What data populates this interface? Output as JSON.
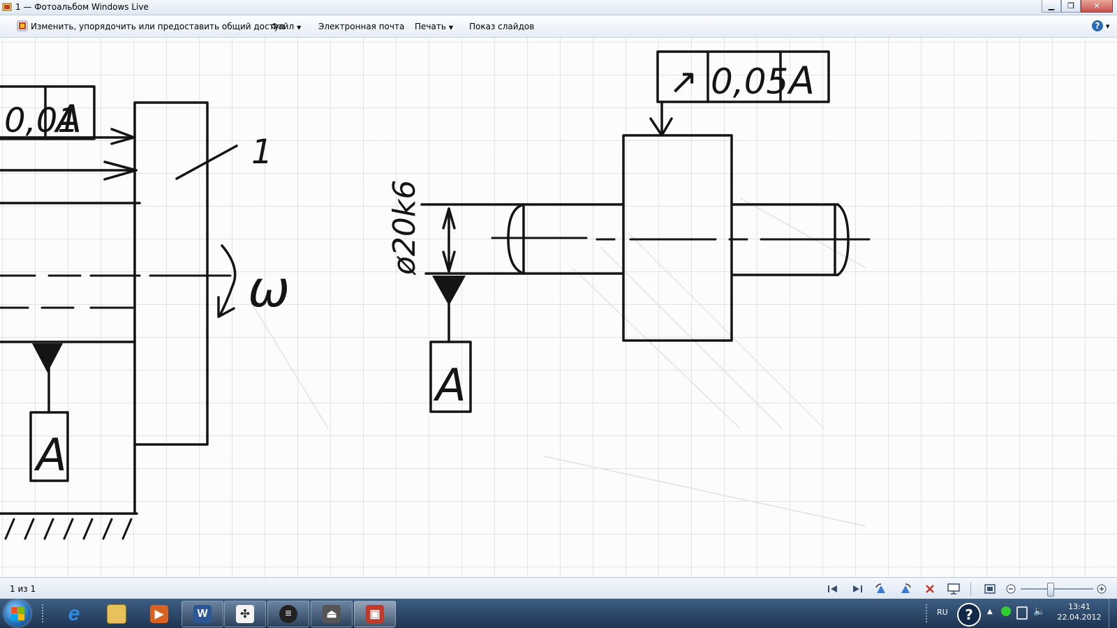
{
  "window": {
    "title": "1 — Фотоальбом Windows Live",
    "buttons": {
      "minimize": "▁",
      "maximize": "❐",
      "close": "✕"
    }
  },
  "toolbar": {
    "edit_label": "Изменить, упорядочить или предоставить общий доступ",
    "file_label": "Файл",
    "email_label": "Электронная почта",
    "print_label": "Печать",
    "slideshow_label": "Показ слайдов",
    "help_label": "?"
  },
  "drawing": {
    "left_frame_text": "0,01",
    "left_frame_datum": "A",
    "left_label_1": "1",
    "left_omega": "ω",
    "left_datum": "A",
    "right_frame_symbol": "↗",
    "right_frame_value": "0,05",
    "right_frame_datum": "A",
    "diameter_label": "ø20k6",
    "right_datum": "A"
  },
  "status": {
    "counter": "1 из 1"
  },
  "tray": {
    "language": "RU",
    "time": "13:41",
    "date": "22.04.2012"
  },
  "colors": {
    "ink": "#141414",
    "grid": "#cfcfcf",
    "taskbar": "#2a4568"
  }
}
